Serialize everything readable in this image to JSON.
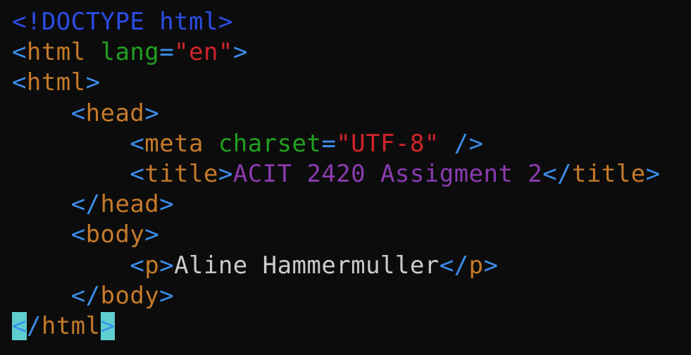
{
  "theme": {
    "background": "#0c0c0c",
    "bracket": "#3b8eea",
    "doctype": "#2b4de6",
    "tag": "#c57a2a",
    "attribute": "#21a021",
    "string": "#d0242a",
    "title_text": "#8b3bb0",
    "text": "#cccccc",
    "bracket_match_highlight": "#5ecece",
    "tilde": "#3b8eea"
  },
  "lines": [
    {
      "indent": 0,
      "tokens": [
        {
          "t": "<!DOCTYPE html>",
          "k": "doctype"
        }
      ]
    },
    {
      "indent": 0,
      "tokens": [
        {
          "t": "<",
          "k": "bracket"
        },
        {
          "t": "html",
          "k": "tag"
        },
        {
          "t": " ",
          "k": "text"
        },
        {
          "t": "lang",
          "k": "attribute"
        },
        {
          "t": "=",
          "k": "bracket"
        },
        {
          "t": "\"en\"",
          "k": "string"
        },
        {
          "t": ">",
          "k": "bracket"
        }
      ]
    },
    {
      "indent": 0,
      "tokens": [
        {
          "t": "<",
          "k": "bracket"
        },
        {
          "t": "html",
          "k": "tag"
        },
        {
          "t": ">",
          "k": "bracket"
        }
      ]
    },
    {
      "indent": 4,
      "tokens": [
        {
          "t": "<",
          "k": "bracket"
        },
        {
          "t": "head",
          "k": "tag"
        },
        {
          "t": ">",
          "k": "bracket"
        }
      ]
    },
    {
      "indent": 8,
      "tokens": [
        {
          "t": "<",
          "k": "bracket"
        },
        {
          "t": "meta",
          "k": "tag"
        },
        {
          "t": " ",
          "k": "text"
        },
        {
          "t": "charset",
          "k": "attribute"
        },
        {
          "t": "=",
          "k": "bracket"
        },
        {
          "t": "\"UTF-8\"",
          "k": "string"
        },
        {
          "t": " />",
          "k": "bracket"
        }
      ]
    },
    {
      "indent": 8,
      "tokens": [
        {
          "t": "<",
          "k": "bracket"
        },
        {
          "t": "title",
          "k": "tag"
        },
        {
          "t": ">",
          "k": "bracket"
        },
        {
          "t": "ACIT 2420 Assigment 2",
          "k": "title_text"
        },
        {
          "t": "</",
          "k": "bracket"
        },
        {
          "t": "title",
          "k": "tag"
        },
        {
          "t": ">",
          "k": "bracket"
        }
      ]
    },
    {
      "indent": 4,
      "tokens": [
        {
          "t": "</",
          "k": "bracket"
        },
        {
          "t": "head",
          "k": "tag"
        },
        {
          "t": ">",
          "k": "bracket"
        }
      ]
    },
    {
      "indent": 4,
      "tokens": [
        {
          "t": "<",
          "k": "bracket"
        },
        {
          "t": "body",
          "k": "tag"
        },
        {
          "t": ">",
          "k": "bracket"
        }
      ]
    },
    {
      "indent": 8,
      "tokens": [
        {
          "t": "<",
          "k": "bracket"
        },
        {
          "t": "p",
          "k": "tag"
        },
        {
          "t": ">",
          "k": "bracket"
        },
        {
          "t": "Aline Hammermuller",
          "k": "text"
        },
        {
          "t": "</",
          "k": "bracket"
        },
        {
          "t": "p",
          "k": "tag"
        },
        {
          "t": ">",
          "k": "bracket"
        }
      ]
    },
    {
      "indent": 4,
      "tokens": [
        {
          "t": "</",
          "k": "bracket"
        },
        {
          "t": "body",
          "k": "tag"
        },
        {
          "t": ">",
          "k": "bracket"
        }
      ]
    },
    {
      "indent": 0,
      "tokens": [
        {
          "t": "<",
          "k": "bracket",
          "hl": true
        },
        {
          "t": "/",
          "k": "bracket"
        },
        {
          "t": "html",
          "k": "tag"
        },
        {
          "t": ">",
          "k": "bracket",
          "hl": true
        }
      ]
    },
    {
      "indent": 0,
      "tokens": [
        {
          "t": "~",
          "k": "tilde"
        }
      ],
      "partial": true
    }
  ]
}
